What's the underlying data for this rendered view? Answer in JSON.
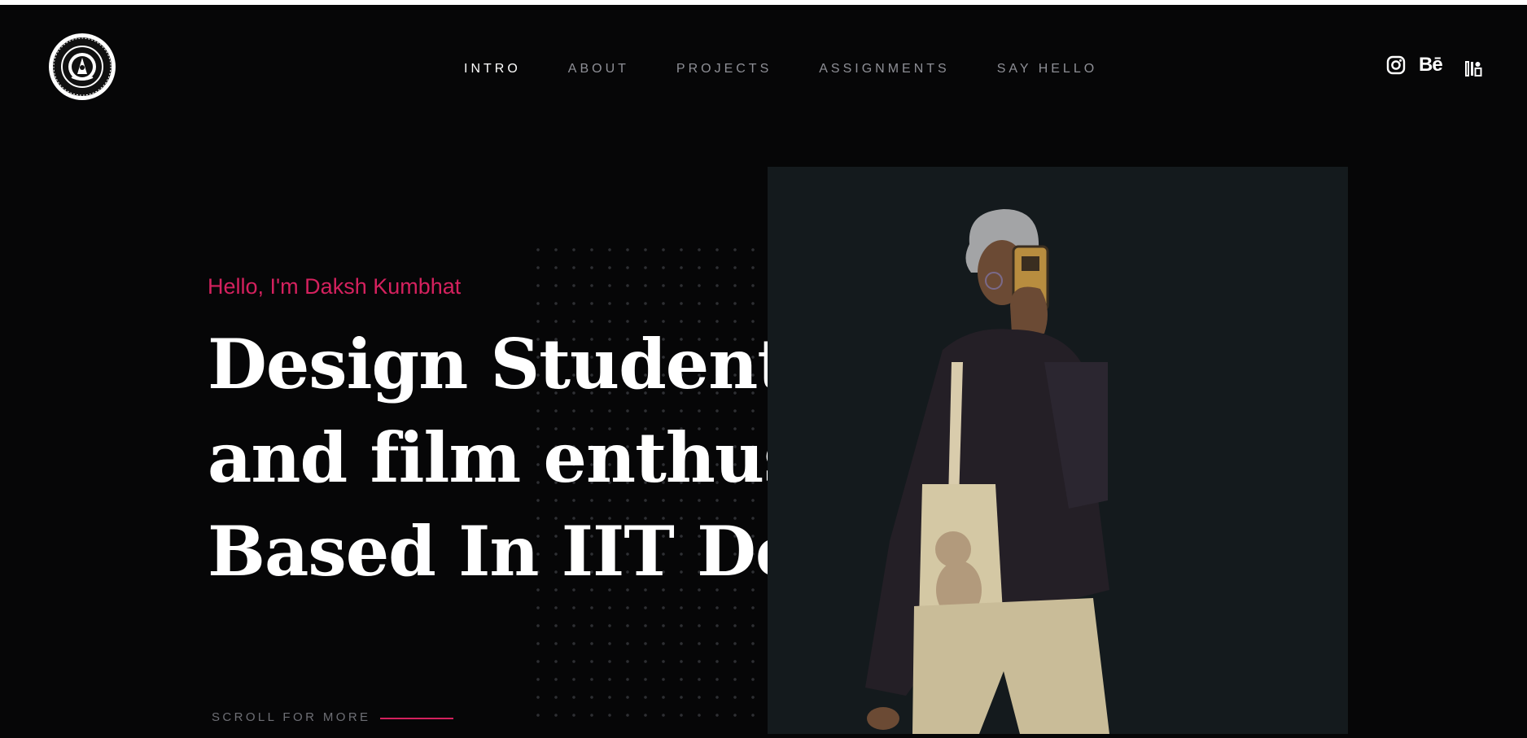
{
  "header": {
    "nav": [
      {
        "label": "INTRO",
        "active": true
      },
      {
        "label": "ABOUT",
        "active": false
      },
      {
        "label": "PROJECTS",
        "active": false
      },
      {
        "label": "ASSIGNMENTS",
        "active": false
      },
      {
        "label": "SAY HELLO",
        "active": false
      }
    ],
    "social": [
      {
        "icon": "instagram-icon"
      },
      {
        "icon": "behance-icon",
        "glyph": "Bē"
      },
      {
        "icon": "issuu-icon"
      }
    ]
  },
  "hero": {
    "greeting": "Hello, I'm Daksh Kumbhat",
    "headline": [
      "Design Student",
      "and film enthusiast",
      "Based In IIT Delhi"
    ],
    "scroll_label": "SCROLL FOR MORE"
  },
  "colors": {
    "accent": "#d4215e",
    "background": "#060607",
    "panel": "#141a1d",
    "nav_inactive": "#8e8f96"
  }
}
